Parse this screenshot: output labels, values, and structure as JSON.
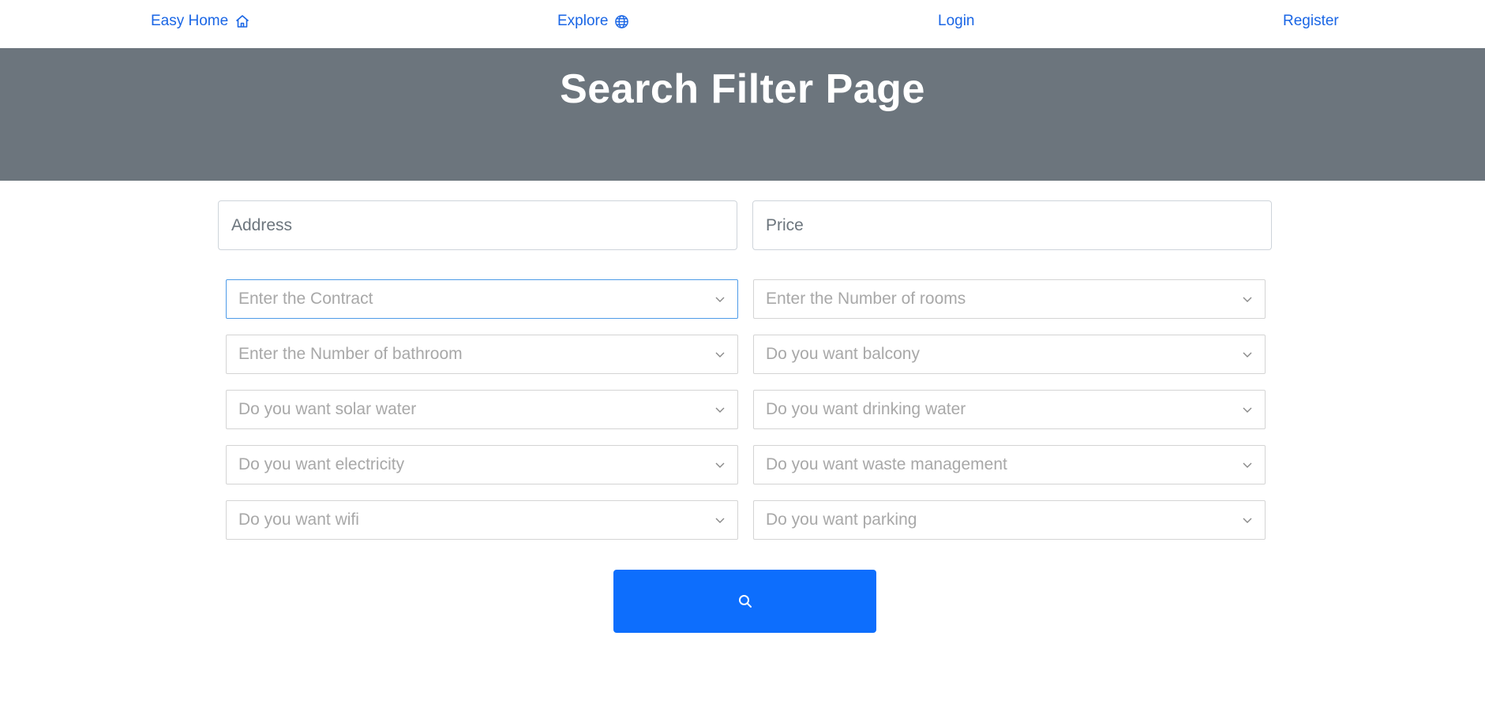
{
  "nav": {
    "brand_label": "Easy Home",
    "brand_icon": "home-icon",
    "explore_label": "Explore",
    "explore_icon": "globe-icon",
    "login_label": "Login",
    "register_label": "Register",
    "link_color": "#1a66e5"
  },
  "hero": {
    "title": "Search Filter Page",
    "background": "#6c757d"
  },
  "filters": {
    "address_placeholder": "Address",
    "price_placeholder": "Price",
    "contract": "Enter the Contract",
    "rooms": "Enter the Number of rooms",
    "bathroom": "Enter the Number of bathroom",
    "balcony": "Do you want balcony",
    "solar_water": "Do you want solar water",
    "drinking_water": "Do you want drinking water",
    "electricity": "Do you want electricity",
    "waste_management": "Do you want waste management",
    "wifi": "Do you want wifi",
    "parking": "Do you want parking"
  },
  "search_button": {
    "icon": "search-icon",
    "color": "#0d6efd"
  }
}
